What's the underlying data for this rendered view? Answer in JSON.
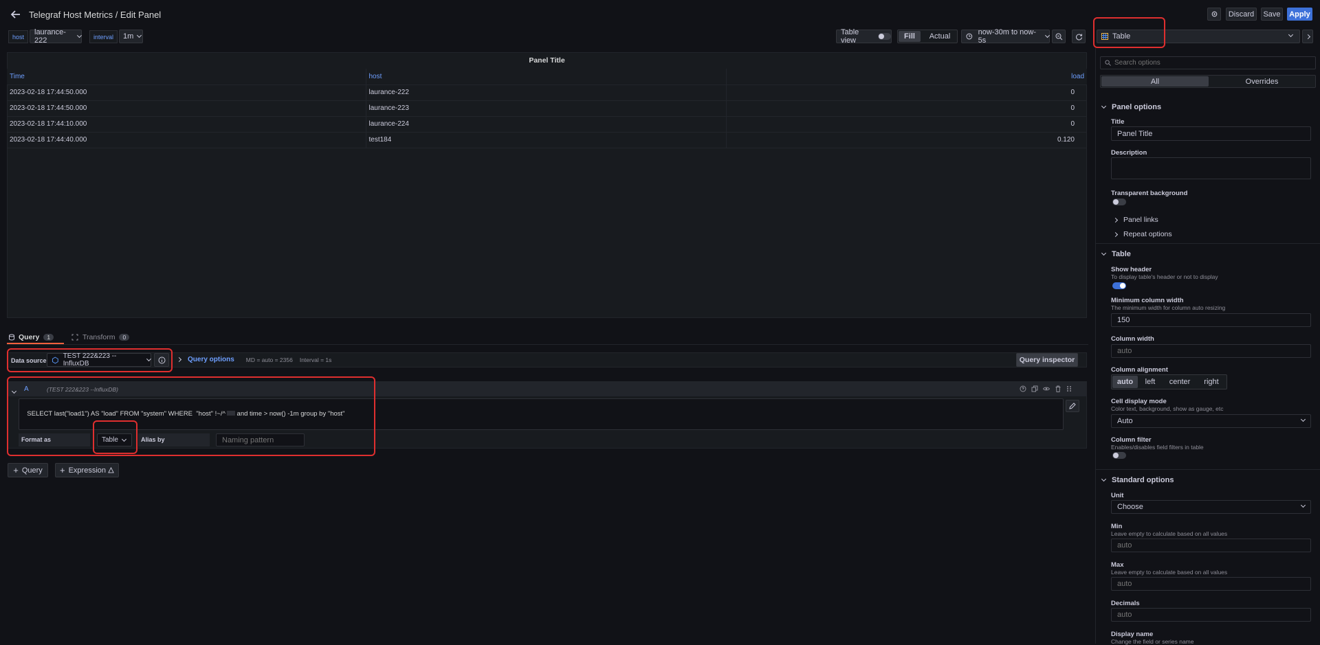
{
  "header": {
    "title": "Telegraf Host Metrics / Edit Panel",
    "discard": "Discard",
    "save": "Save",
    "apply": "Apply"
  },
  "variables": {
    "host_label": "host",
    "host_value": "laurance-222",
    "interval_label": "interval",
    "interval_value": "1m"
  },
  "toolbar": {
    "table_view": "Table view",
    "fill": "Fill",
    "actual": "Actual",
    "time_range": "now-30m to now-5s"
  },
  "panel": {
    "title": "Panel Title",
    "columns": [
      "Time",
      "host",
      "",
      "load"
    ],
    "rows": [
      [
        "2023-02-18 17:44:50.000",
        "laurance-222",
        "",
        "0"
      ],
      [
        "2023-02-18 17:44:50.000",
        "laurance-223",
        "",
        "0"
      ],
      [
        "2023-02-18 17:44:10.000",
        "laurance-224",
        "",
        "0"
      ],
      [
        "2023-02-18 17:44:40.000",
        "test184",
        "",
        "0.120"
      ]
    ]
  },
  "tabs": {
    "query": "Query",
    "query_count": "1",
    "transform": "Transform",
    "transform_count": "0"
  },
  "query_bar": {
    "datasource_label": "Data source",
    "datasource_value": "TEST 222&223 --InfluxDB",
    "options_label": "Query options",
    "md": "MD = auto = 2356",
    "interval": "Interval = 1s",
    "inspector": "Query inspector"
  },
  "query": {
    "ref": "A",
    "ds_hint": "(TEST 222&223 --InfluxDB)",
    "text": "SELECT last(\"load1\") AS \"load\" FROM \"system\" WHERE  \"host\" !~/^",
    "text_tail": " and time > now() -1m group by \"host\"",
    "format_label": "Format as",
    "format_value": "Table",
    "alias_label": "Alias by",
    "alias_placeholder": "Naming pattern"
  },
  "add": {
    "query": "Query",
    "expression": "Expression"
  },
  "options": {
    "viz": "Table",
    "search_placeholder": "Search options",
    "tab_all": "All",
    "tab_overrides": "Overrides",
    "panel_options": "Panel options",
    "title_label": "Title",
    "title_value": "Panel Title",
    "description_label": "Description",
    "transparent_label": "Transparent background",
    "panel_links": "Panel links",
    "repeat_options": "Repeat options",
    "table_section": "Table",
    "show_header": "Show header",
    "show_header_desc": "To display table's header or not to display",
    "min_col_width": "Minimum column width",
    "min_col_width_desc": "The minimum width for column auto resizing",
    "min_col_width_value": "150",
    "col_width": "Column width",
    "col_width_placeholder": "auto",
    "col_align": "Column alignment",
    "align_opts": [
      "auto",
      "left",
      "center",
      "right"
    ],
    "cell_mode": "Cell display mode",
    "cell_mode_desc": "Color text, background, show as gauge, etc",
    "cell_mode_value": "Auto",
    "col_filter": "Column filter",
    "col_filter_desc": "Enables/disables field filters in table",
    "standard": "Standard options",
    "unit": "Unit",
    "unit_placeholder": "Choose",
    "min": "Min",
    "min_desc": "Leave empty to calculate based on all values",
    "min_placeholder": "auto",
    "max": "Max",
    "max_desc": "Leave empty to calculate based on all values",
    "max_placeholder": "auto",
    "decimals": "Decimals",
    "decimals_placeholder": "auto",
    "display_name": "Display name",
    "display_name_desc": "Change the field or series name"
  },
  "colors": {
    "accent": "#3d71d9",
    "link": "#6e9fff",
    "highlight": "#e02f2f"
  }
}
